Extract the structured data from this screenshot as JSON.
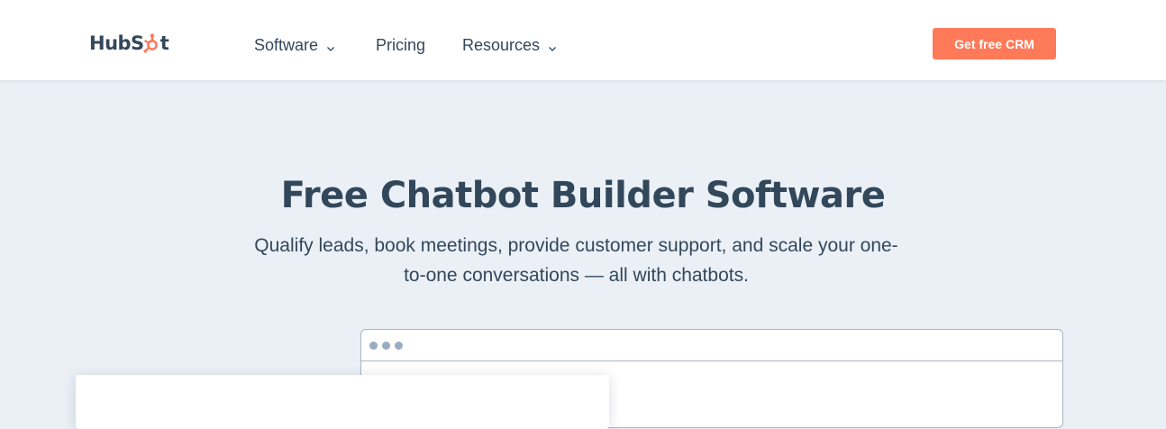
{
  "nav": {
    "logo_text_left": "HubS",
    "logo_text_right": "t",
    "logo_icon": "sprocket-icon",
    "items": [
      {
        "label": "Software",
        "has_dropdown": true
      },
      {
        "label": "Pricing",
        "has_dropdown": false
      },
      {
        "label": "Resources",
        "has_dropdown": true
      }
    ],
    "cta_label": "Get free CRM"
  },
  "hero": {
    "title": "Free Chatbot Builder Software",
    "subtitle": "Qualify leads, book meetings, provide customer support, and scale your one-to-one conversations — all with chatbots."
  },
  "colors": {
    "accent": "#ff7a59",
    "text": "#33475b",
    "background": "#eaf0f6",
    "nav_background": "#ffffff"
  }
}
